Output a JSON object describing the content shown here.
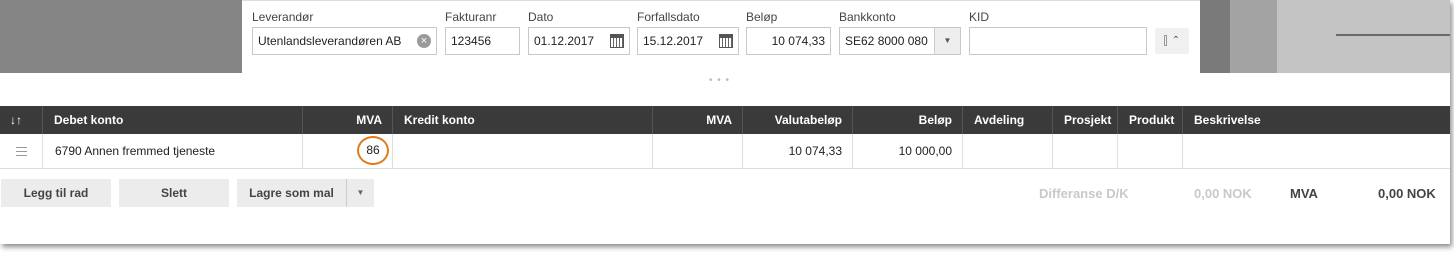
{
  "header": {
    "fields": {
      "supplier": {
        "label": "Leverandør",
        "value": "Utenlandsleverandøren AB"
      },
      "invoice_no": {
        "label": "Fakturanr",
        "value": "123456"
      },
      "date": {
        "label": "Dato",
        "value": "01.12.2017"
      },
      "due_date": {
        "label": "Forfallsdato",
        "value": "15.12.2017"
      },
      "amount": {
        "label": "Beløp",
        "value": "10 074,33"
      },
      "bank_account": {
        "label": "Bankkonto",
        "value": "SE62 8000 080"
      },
      "kid": {
        "label": "KID",
        "value": ""
      }
    },
    "collapse_icon": "chevron-double-up",
    "drag_handle": "• • •"
  },
  "table": {
    "sort_icon": "↓↑",
    "columns": {
      "debet_konto": "Debet konto",
      "mva1": "MVA",
      "kredit_konto": "Kredit konto",
      "mva2": "MVA",
      "valutabelop": "Valutabeløp",
      "belop": "Beløp",
      "avdeling": "Avdeling",
      "prosjekt": "Prosjekt",
      "produkt": "Produkt",
      "beskrivelse": "Beskrivelse"
    },
    "rows": [
      {
        "debet_konto": "6790 Annen fremmed tjeneste",
        "mva1": "86",
        "kredit_konto": "",
        "mva2": "",
        "valutabelop": "10 074,33",
        "belop": "10 000,00",
        "avdeling": "",
        "prosjekt": "",
        "produkt": "",
        "beskrivelse": ""
      }
    ]
  },
  "actions": {
    "add_row": "Legg til rad",
    "delete": "Slett",
    "save_template": "Lagre som mal"
  },
  "summary": {
    "diff_label": "Differanse D/K",
    "diff_value": "0,00 NOK",
    "mva_label": "MVA",
    "mva_value": "0,00 NOK"
  },
  "colors": {
    "highlight": "#e07b1f",
    "table_header": "#3a3a3a"
  }
}
